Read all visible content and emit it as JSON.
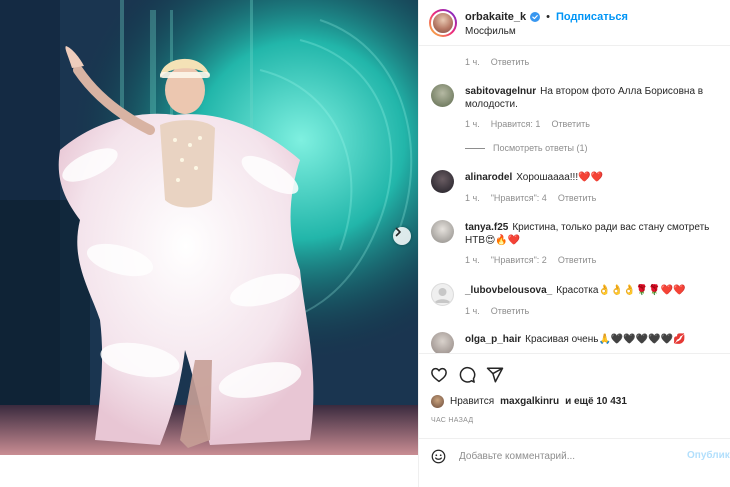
{
  "post": {
    "author": "orbakaite_k",
    "separator": "•",
    "follow_label": "Подписаться",
    "location": "Мосфильм",
    "verified_icon": "verified-badge-icon"
  },
  "comments": [
    {
      "username": "",
      "text": "",
      "time": "1 ч.",
      "likes": "",
      "reply_label": "Ответить"
    },
    {
      "username": "sabitovagelnur",
      "text": "На втором фото Алла Борисовна в молодости.",
      "time": "1 ч.",
      "likes": "Нравится: 1",
      "reply_label": "Ответить"
    },
    {
      "username": "alinarodel",
      "text": "Хорошаааа!!!❤️❤️",
      "time": "1 ч.",
      "likes": "\"Нравится\": 4",
      "reply_label": "Ответить"
    },
    {
      "username": "tanya.f25",
      "text": "Кристина, только ради вас стану смотреть НТВ😍🔥❤️",
      "time": "1 ч.",
      "likes": "\"Нравится\": 2",
      "reply_label": "Ответить"
    },
    {
      "username": "_lubovbelousova_",
      "text": "Красотка👌👌👌🌹🌹❤️❤️",
      "time": "1 ч.",
      "likes": "",
      "reply_label": "Ответить"
    },
    {
      "username": "olga_p_hair",
      "text": "Красивая очень🙏🖤🖤🖤🖤🖤💋",
      "time": "",
      "likes": "",
      "reply_label": ""
    }
  ],
  "view_replies_label": "Посмотреть ответы (1)",
  "actions": {
    "like_icon": "heart-icon",
    "comment_icon": "comment-icon",
    "share_icon": "share-icon"
  },
  "likes": {
    "prefix": "Нравится",
    "user": "maxgalkinru",
    "and_more": "и ещё 10 431"
  },
  "timestamp": "ЧАС НАЗАД",
  "add_comment": {
    "placeholder": "Добавьте комментарий...",
    "publish_label": "Опубликовать",
    "emoji_icon": "emoji-icon"
  },
  "colors": {
    "accent": "#0095f6",
    "publish_disabled": "#b2dffc",
    "muted_text": "#8e8e8e",
    "text": "#262626",
    "border": "#efefef"
  }
}
